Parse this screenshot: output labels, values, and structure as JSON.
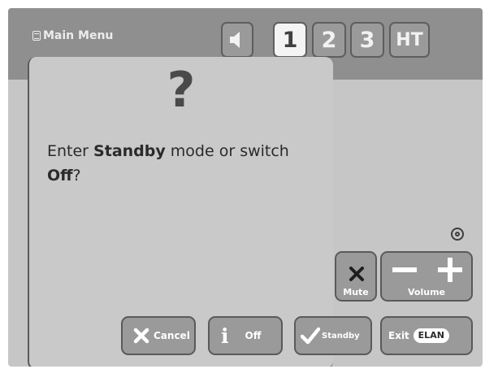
{
  "header": {
    "menu_label": "Main Menu",
    "zones": [
      "1",
      "2",
      "3"
    ],
    "ht_label": "HT"
  },
  "dialog": {
    "question_mark": "?",
    "message_prefix": "Enter ",
    "message_bold1": "Standby",
    "message_middle": " mode or switch ",
    "message_bold2": "Off",
    "message_suffix": "?"
  },
  "controls": {
    "mute_label": "Mute",
    "volume_label": "Volume"
  },
  "actions": {
    "cancel_label": "Cancel",
    "off_label": "Off",
    "standby_label": "Standby",
    "exit_label": "Exit",
    "logo_text": "ELAN"
  },
  "colors": {
    "background": "#c6c6c6",
    "header": "#8f8f8f",
    "button": "#9a9a9a",
    "active_tab": "#f4f4f4"
  }
}
